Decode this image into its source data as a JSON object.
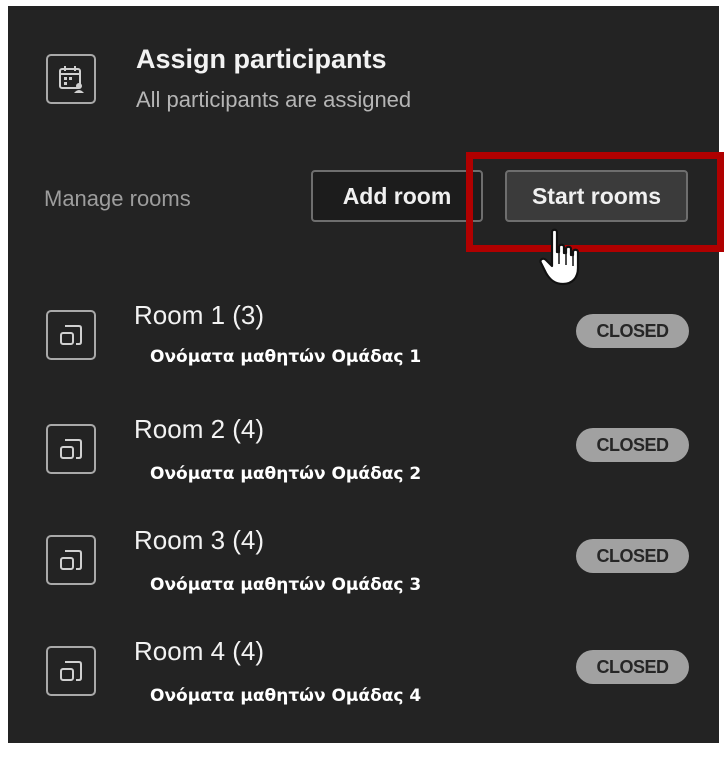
{
  "header": {
    "icon": "calendar-people-icon",
    "title": "Assign participants",
    "subtitle": "All participants are assigned"
  },
  "manage": {
    "label": "Manage rooms",
    "add_room_label": "Add room",
    "start_rooms_label": "Start rooms"
  },
  "colors": {
    "panel_background": "#232323",
    "highlight": "#b00000",
    "badge": "#a1a1a1"
  },
  "rooms": [
    {
      "name": "Room 1 (3)",
      "members": "Ονόματα μαθητών Ομάδας 1",
      "status": "CLOSED",
      "icon": "breakout-room-icon"
    },
    {
      "name": "Room 2 (4)",
      "members": "Ονόματα μαθητών Ομάδας 2",
      "status": "CLOSED",
      "icon": "breakout-room-icon"
    },
    {
      "name": "Room 3 (4)",
      "members": "Ονόματα μαθητών Ομάδας 3",
      "status": "CLOSED",
      "icon": "breakout-room-icon"
    },
    {
      "name": "Room 4 (4)",
      "members": "Ονόματα μαθητών Ομάδας 4",
      "status": "CLOSED",
      "icon": "breakout-room-icon"
    }
  ]
}
